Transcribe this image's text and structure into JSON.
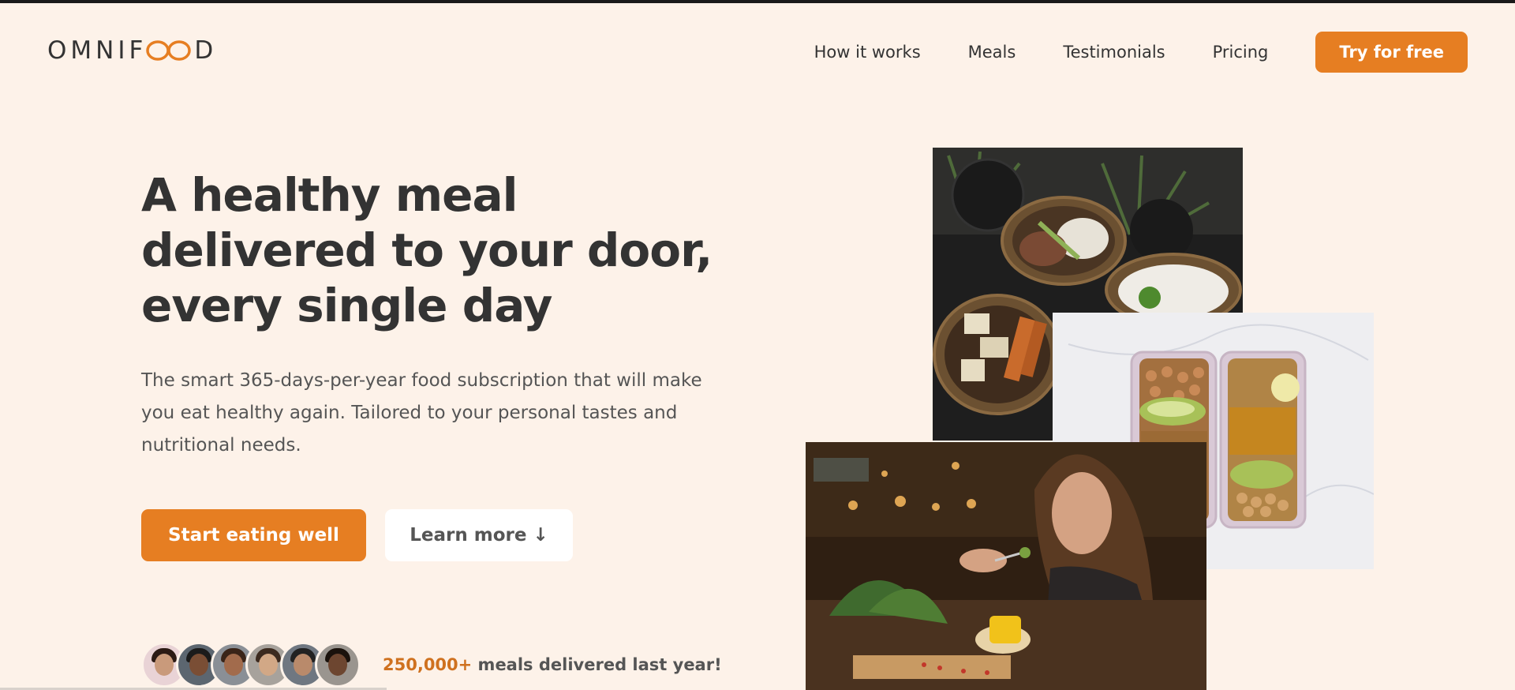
{
  "brand": {
    "logo_left": "OMNIF",
    "logo_right": "D",
    "accent": "#e67e22",
    "background": "#fdf2e9"
  },
  "nav": {
    "items": [
      "How it works",
      "Meals",
      "Testimonials",
      "Pricing"
    ],
    "cta": "Try for free"
  },
  "hero": {
    "title_line1": "A healthy meal",
    "title_line2": "delivered to your door,",
    "title_line3": "every single day",
    "description": "The smart 365-days-per-year food subscription that will make you eat healthy again. Tailored to your personal tastes and nutritional needs.",
    "primary_button": "Start eating well",
    "secondary_button": "Learn more ↓"
  },
  "delivered": {
    "count": "250,000+",
    "text": " meals delivered last year!",
    "avatars": [
      "customer-1",
      "customer-2",
      "customer-3",
      "customer-4",
      "customer-5",
      "customer-6"
    ]
  },
  "images": [
    "bowls-photo",
    "meal-prep-boxes-photo",
    "woman-eating-photo"
  ]
}
